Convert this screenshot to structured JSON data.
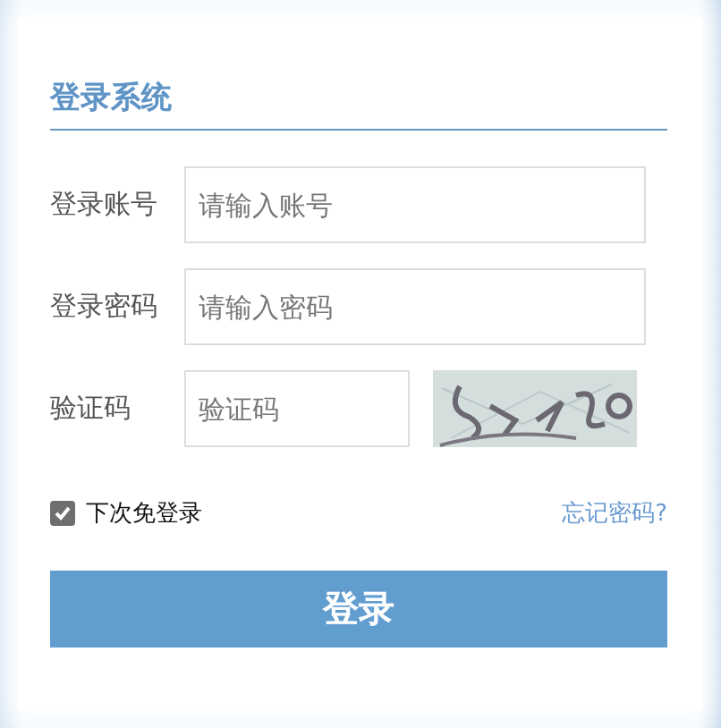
{
  "title": "登录系统",
  "fields": [
    {
      "label": "登录账号",
      "placeholder": "请输入账号",
      "kind": "text"
    },
    {
      "label": "登录密码",
      "placeholder": "请输入密码",
      "kind": "password"
    },
    {
      "label": "验证码",
      "placeholder": "验证码",
      "kind": "captcha"
    }
  ],
  "remember": {
    "label": "下次免登录",
    "checked": true
  },
  "forgot_link": "忘记密码?",
  "submit": "登录"
}
